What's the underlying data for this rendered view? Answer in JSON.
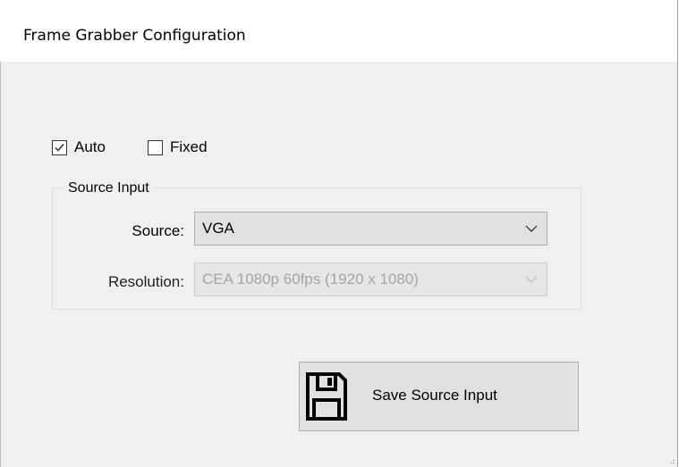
{
  "window": {
    "title": "Frame Grabber Configuration"
  },
  "mode": {
    "auto": {
      "label": "Auto",
      "checked": true
    },
    "fixed": {
      "label": "Fixed",
      "checked": false
    }
  },
  "source_input": {
    "group_label": "Source Input",
    "source": {
      "label": "Source:",
      "value": "VGA"
    },
    "resolution": {
      "label": "Resolution:",
      "value": "CEA 1080p 60fps (1920 x 1080)",
      "enabled": false
    }
  },
  "save_button": {
    "label": "Save Source Input",
    "icon": "floppy-disk-icon"
  },
  "colors": {
    "accent_border": "#1a7fd0",
    "window_bg": "#f0f0f0",
    "disabled_text": "#a6a6a6"
  }
}
